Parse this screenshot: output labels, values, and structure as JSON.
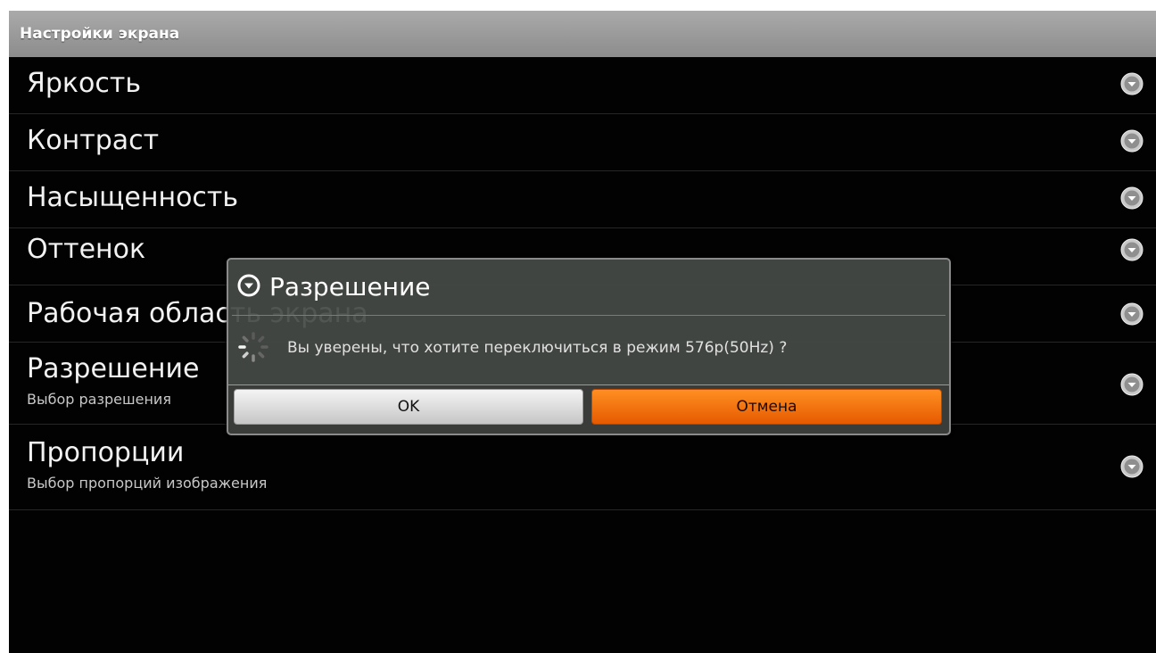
{
  "header": {
    "title": "Настройки экрана"
  },
  "settings": {
    "items": [
      {
        "title": "Яркость",
        "subtitle": ""
      },
      {
        "title": "Контраст",
        "subtitle": ""
      },
      {
        "title": "Насыщенность",
        "subtitle": ""
      },
      {
        "title": "Оттенок",
        "subtitle": ""
      },
      {
        "title": "Рабочая область экрана",
        "subtitle": ""
      },
      {
        "title": "Разрешение",
        "subtitle": "Выбор разрешения"
      },
      {
        "title": "Пропорции",
        "subtitle": "Выбор пропорций изображения"
      }
    ],
    "row_icon": "chevron-down-circle-icon"
  },
  "dialog": {
    "title": "Разрешение",
    "title_icon": "chevron-down-circle-icon",
    "message": "Вы уверены, что хотите переключиться в режим 576p(50Hz) ?",
    "progress_icon": "loading-spinner-icon",
    "ok_label": "OK",
    "cancel_label": "Отмена"
  },
  "colors": {
    "background": "#020202",
    "header": "#9c9c9c",
    "accent": "#f07010",
    "dialog": "#464a46"
  }
}
